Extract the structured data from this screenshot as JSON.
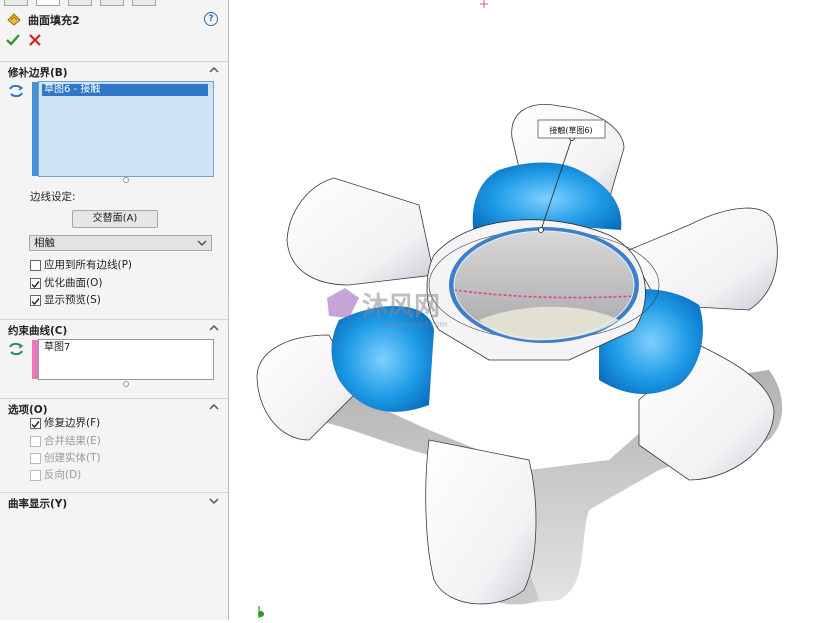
{
  "feature": {
    "title": "曲面填充2",
    "help_icon": "?"
  },
  "actions": {
    "ok_icon": "check-icon",
    "cancel_icon": "x-icon"
  },
  "patch_boundary": {
    "header": "修补边界(B)",
    "items": [
      "草图6 - 接触"
    ],
    "edge_settings_label": "边线设定:",
    "alternate_face_button": "交替面(A)",
    "contact_dropdown": "相触",
    "checkboxes": [
      {
        "label": "应用到所有边线(P)",
        "checked": false,
        "enabled": true
      },
      {
        "label": "优化曲面(O)",
        "checked": true,
        "enabled": true
      },
      {
        "label": "显示预览(S)",
        "checked": true,
        "enabled": true
      }
    ]
  },
  "constraint_curves": {
    "header": "约束曲线(C)",
    "items": [
      "草图7"
    ]
  },
  "options": {
    "header": "选项(O)",
    "checkboxes": [
      {
        "label": "修复边界(F)",
        "checked": true,
        "enabled": true
      },
      {
        "label": "合并结果(E)",
        "checked": false,
        "enabled": false
      },
      {
        "label": "创建实体(T)",
        "checked": false,
        "enabled": false
      },
      {
        "label": "反向(D)",
        "checked": false,
        "enabled": false
      }
    ]
  },
  "curvature_display": {
    "header": "曲率显示(Y)"
  },
  "viewport": {
    "callout": "接触(草图6)",
    "watermark_main": "沐风网",
    "watermark_url": "www.mfcad.com",
    "colors": {
      "patch_blue": "#1e9be6",
      "selection_blue": "#2f78c8",
      "edge_pink": "#e040a0"
    }
  }
}
